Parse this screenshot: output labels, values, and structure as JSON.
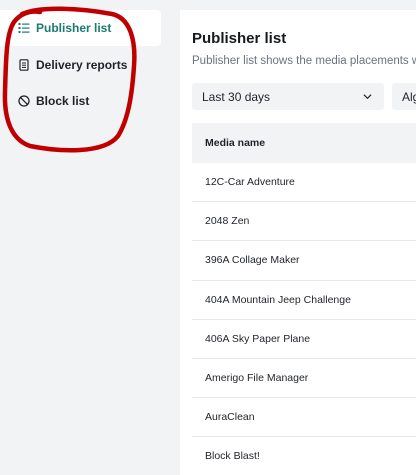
{
  "sidebar": {
    "items": [
      {
        "label": "Publisher list",
        "icon": "list-icon",
        "active": true
      },
      {
        "label": "Delivery reports",
        "icon": "document-icon",
        "active": false
      },
      {
        "label": "Block list",
        "icon": "block-icon",
        "active": false
      }
    ]
  },
  "main": {
    "title": "Publisher list",
    "description": "Publisher list shows the media placements w",
    "filters": {
      "date_range": "Last 30 days",
      "algorithm": "Alg"
    },
    "table": {
      "column_header": "Media name",
      "rows": [
        "12C-Car Adventure",
        "2048 Zen",
        "396A Collage Maker",
        "404A Mountain Jeep Challenge",
        "406A Sky Paper Plane",
        "Amerigo File Manager",
        "AuraClean",
        "Block Blast!"
      ]
    }
  },
  "colors": {
    "accent": "#1b7a73",
    "annotation": "#c00000",
    "page_background": "#f2f3f5"
  }
}
